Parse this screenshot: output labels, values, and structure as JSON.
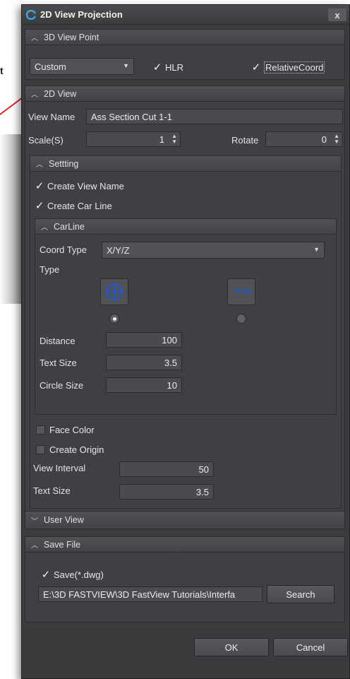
{
  "background": {
    "partial_text": "t"
  },
  "window": {
    "title": "2D View Projection",
    "close": "x"
  },
  "view_point": {
    "header": "3D View Point",
    "preset": "Custom",
    "hlr_label": "HLR",
    "relative_label": "RelativeCoord"
  },
  "view2d": {
    "header": "2D View",
    "view_name_label": "View Name",
    "view_name_value": "Ass Section Cut 1-1",
    "scale_label": "Scale(S)",
    "scale_value": "1",
    "rotate_label": "Rotate",
    "rotate_value": "0"
  },
  "setting": {
    "header": "Settting",
    "create_view_name": "Create View Name",
    "create_car_line": "Create Car Line",
    "carline": {
      "header": "CarLine",
      "coord_type_label": "Coord Type",
      "coord_type_value": "X/Y/Z",
      "type_label": "Type",
      "type2_text": "+++X",
      "distance_label": "Distance",
      "distance_value": "100",
      "text_size_label": "Text Size",
      "text_size_value": "3.5",
      "circle_size_label": "Circle Size",
      "circle_size_value": "10"
    },
    "face_color": "Face Color",
    "create_origin": "Create Origin",
    "view_interval_label": "View Interval",
    "view_interval_value": "50",
    "text_size_label": "Text Size",
    "text_size_value": "3.5"
  },
  "user_view": {
    "header": "User View"
  },
  "save_file": {
    "header": "Save File",
    "save_label": "Save(*.dwg)",
    "path": "E:\\3D FASTVIEW\\3D FastView Tutorials\\Interfa",
    "search_button": "Search"
  },
  "footer": {
    "ok": "OK",
    "cancel": "Cancel"
  },
  "colors": {
    "accent": "#1a5ad8",
    "panel": "#3f4043",
    "pointer_line": "#e0202a"
  }
}
